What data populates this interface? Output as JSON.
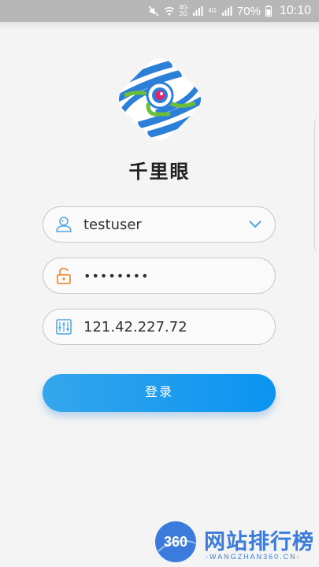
{
  "status_bar": {
    "network_top": "4G",
    "network_bottom": "2G",
    "network_alt": "4G",
    "battery": "70%",
    "time": "10:10"
  },
  "app": {
    "title": "千里眼"
  },
  "form": {
    "username": "testuser",
    "password": "••••••••",
    "server": "121.42.227.72"
  },
  "login_button": "登录",
  "watermark": {
    "circle_text": "360",
    "title": "网站排行榜",
    "subtitle": "-WANGZHAN360.CN-"
  },
  "colors": {
    "accent": "#1a9cf0",
    "logo_blue": "#2b7fd6",
    "logo_green": "#6abf3a",
    "logo_pink": "#e0246e"
  }
}
